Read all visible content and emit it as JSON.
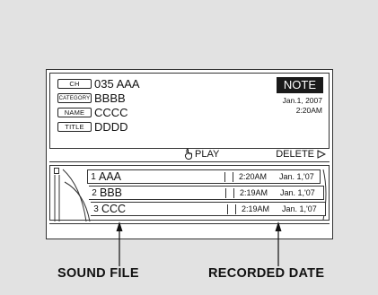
{
  "info": {
    "ch_label": "CH",
    "ch_value": "035 AAA",
    "category_label": "CATEGORY",
    "category_value": "BBBB",
    "name_label": "NAME",
    "name_value": "CCCC",
    "title_label": "TITLE",
    "title_value": "DDDD",
    "note_label": "NOTE",
    "date": "Jan.1, 2007",
    "time": "2:20AM"
  },
  "actions": {
    "play_label": "PLAY",
    "delete_label": "DELETE"
  },
  "list": [
    {
      "num": "1",
      "name": "AAA",
      "time": "2:20AM",
      "date": "Jan. 1,'07"
    },
    {
      "num": "2",
      "name": "BBB",
      "time": "2:19AM",
      "date": "Jan. 1,'07"
    },
    {
      "num": "3",
      "name": "CCC",
      "time": "2:19AM",
      "date": "Jan. 1,'07"
    }
  ],
  "captions": {
    "sound_file": "SOUND FILE",
    "recorded_date": "RECORDED DATE"
  },
  "icons": {
    "play": "play-hand-icon",
    "delete": "triangle-right-icon"
  }
}
